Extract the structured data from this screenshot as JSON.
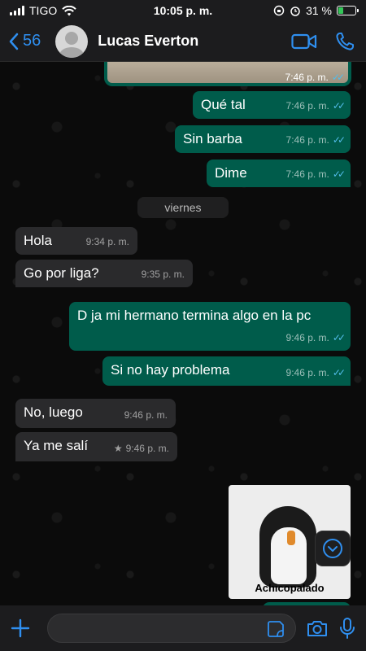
{
  "status": {
    "carrier": "TIGO",
    "time": "10:05 p. m.",
    "battery": "31 %",
    "battery_level": 0.31
  },
  "header": {
    "back_count": "56",
    "contact_name": "Lucas Everton"
  },
  "messages": {
    "img_time": "7:46 p. m.",
    "m1_text": "Qué tal",
    "m1_time": "7:46 p. m.",
    "m2_text": "Sin barba",
    "m2_time": "7:46 p. m.",
    "m3_text": "Dime",
    "m3_time": "7:46 p. m.",
    "day_label": "viernes",
    "m4_text": "Hola",
    "m4_time": "9:34 p. m.",
    "m5_text": "Go por liga?",
    "m5_time": "9:35 p. m.",
    "m6_text": "D ja mi hermano termina algo en la pc",
    "m6_time": "9:46 p. m.",
    "m7_text": "Si no hay problema",
    "m7_time": "9:46 p. m.",
    "m8_text": "No, luego",
    "m8_time": "9:46 p. m.",
    "m9_text": "Ya me salí",
    "m9_time": "9:46 p. m.",
    "sticker_caption": "Achicopalado"
  },
  "composer": {
    "placeholder": ""
  },
  "colors": {
    "accent": "#2f8ff0",
    "outgoing_bubble": "#005c4b",
    "incoming_bubble": "#2a2a2c",
    "read_ticks": "#53bdeb"
  }
}
